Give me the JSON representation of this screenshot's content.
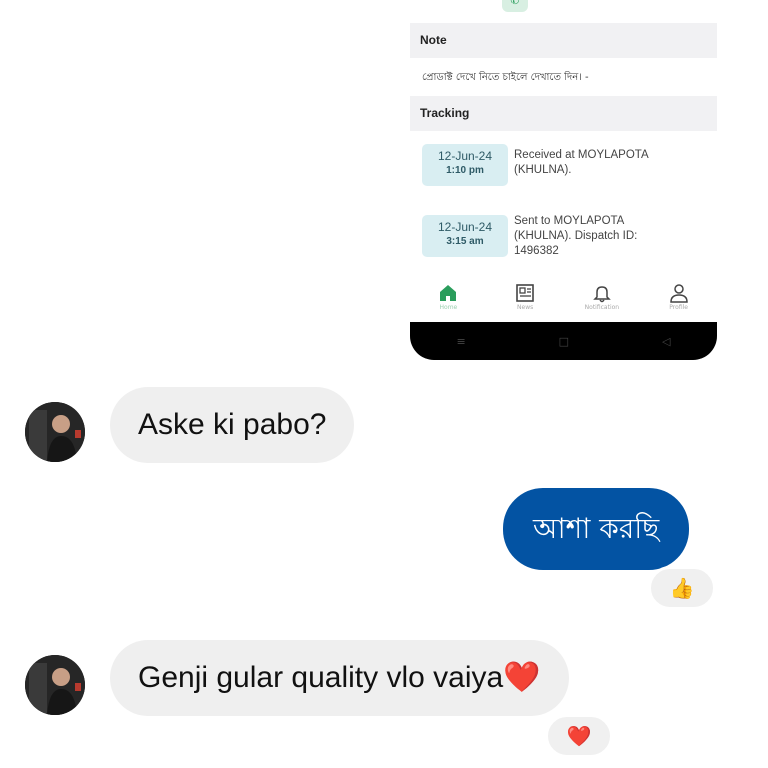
{
  "screenshot": {
    "note_header": "Note",
    "note_text": "প্রোডাক্ট দেখে নিতে চাইলে দেখাতে দিন। -",
    "tracking_header": "Tracking",
    "tracking": [
      {
        "date": "12-Jun-24",
        "time": "1:10 pm",
        "text": "Received at MOYLAPOTA (KHULNA)."
      },
      {
        "date": "12-Jun-24",
        "time": "3:15 am",
        "text": "Sent to MOYLAPOTA (KHULNA). Dispatch ID: 1496382"
      }
    ],
    "nav": [
      {
        "label": "Home",
        "icon": "home-icon",
        "active": true
      },
      {
        "label": "News",
        "icon": "news-icon",
        "active": false
      },
      {
        "label": "Notification",
        "icon": "bell-icon",
        "active": false
      },
      {
        "label": "Profile",
        "icon": "person-icon",
        "active": false
      }
    ],
    "colors": {
      "accent": "#2a9d5c",
      "date_bg": "#d9eef2"
    }
  },
  "messages": [
    {
      "side": "incoming",
      "text": "Aske ki pabo?"
    },
    {
      "side": "outgoing",
      "text": "আশা করছি",
      "reaction": "👍"
    },
    {
      "side": "incoming",
      "text": "Genji gular quality vlo vaiya❤️",
      "reaction": "❤️"
    }
  ],
  "colors": {
    "outgoing_bubble": "#0353a3",
    "incoming_bubble": "#efefef"
  }
}
